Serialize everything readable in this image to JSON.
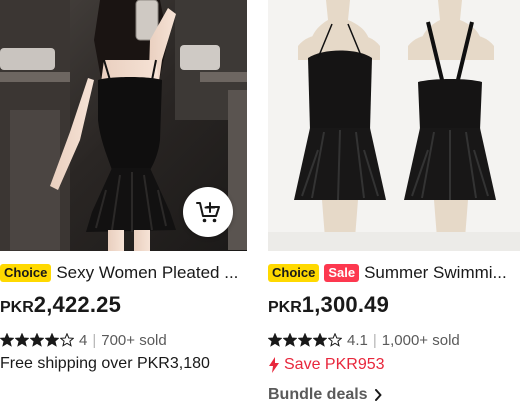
{
  "products": [
    {
      "badges": [
        "Choice"
      ],
      "title": "Sexy Women Pleated ...",
      "currency": "PKR",
      "price": "2,422.25",
      "rating": 4,
      "rating_text": "4",
      "sold": "700+ sold",
      "shipping": "Free shipping over PKR3,180",
      "image_icon": "woman-in-black-swim-dress-photo",
      "cart_icon": "add-to-cart-icon"
    },
    {
      "badges": [
        "Choice",
        "Sale"
      ],
      "title": "Summer Swimmi...",
      "currency": "PKR",
      "price": "1,300.49",
      "rating": 4.1,
      "rating_text": "4.1",
      "sold": "1,000+ sold",
      "save": "Save PKR953",
      "bundle": "Bundle deals",
      "image_icon": "black-swim-dress-on-mannequins-photo"
    }
  ],
  "colors": {
    "choice_badge": "#ffd900",
    "sale_badge": "#fd384f",
    "save_red": "#e8273c",
    "text": "#191919",
    "muted": "#5a5a5a"
  }
}
